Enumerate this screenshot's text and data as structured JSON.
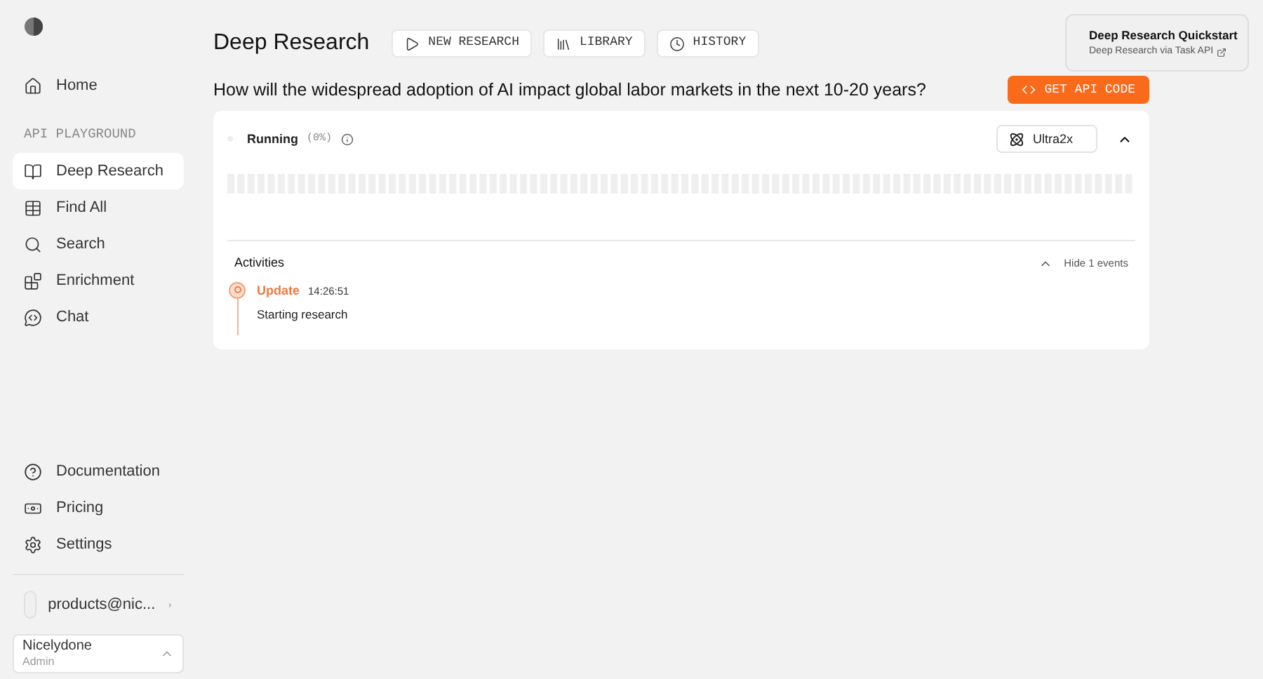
{
  "sidebar": {
    "top_items": [
      {
        "label": "Home",
        "selected": false
      }
    ],
    "section_label": "API PLAYGROUND",
    "items": [
      {
        "label": "Deep Research",
        "selected": true
      },
      {
        "label": "Find All",
        "selected": false
      },
      {
        "label": "Search",
        "selected": false
      },
      {
        "label": "Enrichment",
        "selected": false
      },
      {
        "label": "Chat",
        "selected": false
      }
    ],
    "bottom_items": [
      {
        "label": "Documentation"
      },
      {
        "label": "Pricing"
      },
      {
        "label": "Settings"
      }
    ],
    "account": "products@nic...",
    "org": {
      "name": "Nicelydone",
      "role": "Admin"
    }
  },
  "header": {
    "title": "Deep Research",
    "buttons": [
      {
        "label": "NEW RESEARCH"
      },
      {
        "label": "LIBRARY"
      },
      {
        "label": "HISTORY"
      }
    ],
    "quickstart": {
      "title": "Deep Research Quickstart",
      "link": "Deep Research via Task API"
    }
  },
  "question": "How will the widespread adoption of AI impact global labor markets in the next 10-20 years?",
  "api_button": "GET API CODE",
  "run": {
    "status": "Running",
    "percent": "(0%)",
    "processor": "Ultra2x",
    "expanded": true
  },
  "activities": {
    "title": "Activities",
    "toggle": "Hide 1 events",
    "events": [
      {
        "type": "Update",
        "time": "14:26:51",
        "text": "Starting research"
      }
    ]
  }
}
